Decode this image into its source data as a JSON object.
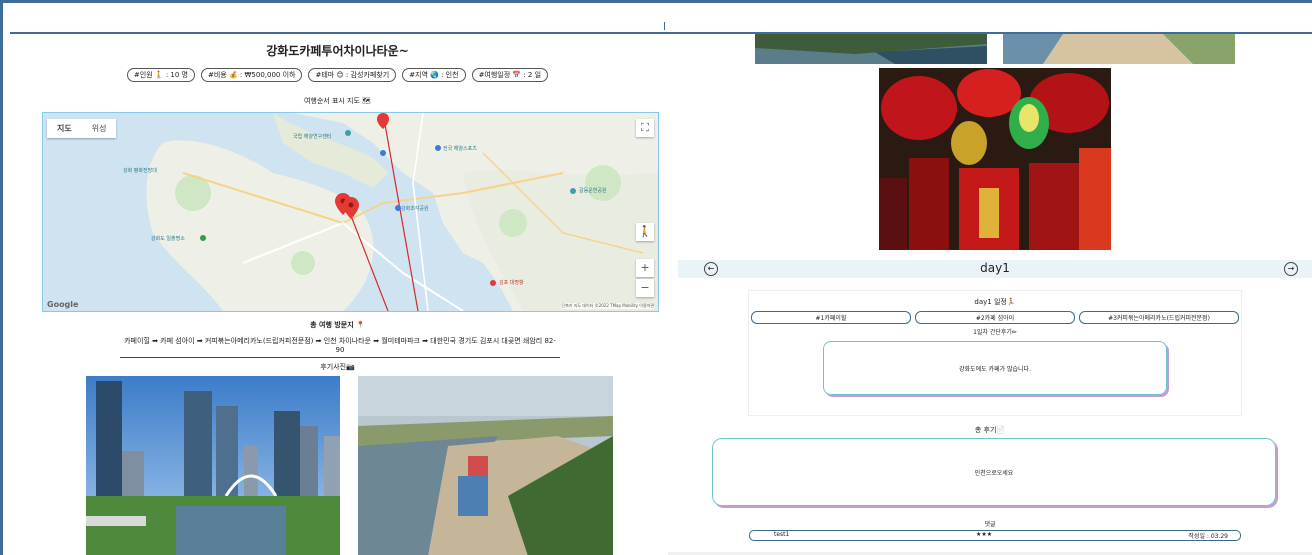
{
  "trip": {
    "title": "강화도카페투어차이나타운~",
    "tags": [
      {
        "label": "#인원 🚶 : 10 명"
      },
      {
        "label": "#비용 💰 : ₩500,000 이하"
      },
      {
        "label": "#테마 😊 : 감성카페찾기"
      },
      {
        "label": "#지역 🌏 : 인천"
      },
      {
        "label": "#여행일정 📅 : 2 일"
      }
    ]
  },
  "map": {
    "caption": "여행순서 표시 지도 🗺",
    "type_tabs": [
      "지도",
      "위성"
    ],
    "google": "Google",
    "footer": "단축키  지도 데이터 ©2022 TMap Mobility  이용약관",
    "labels": [
      {
        "text": "국립 해양연구센터"
      },
      {
        "text": "강화 평화전망대"
      },
      {
        "text": "강화도 일출명소"
      },
      {
        "text": "강화조각공원"
      },
      {
        "text": "갈등운연공원"
      },
      {
        "text": "전국 해양스포츠"
      },
      {
        "text": "김포 대명항"
      }
    ]
  },
  "visits": {
    "caption": "총 여행 방문지 📍",
    "route": "카페이힐 ➡ 카페 섬아이 ➡ 커피볶는아메리카노(드립커피전문점) ➡ 인천 차이나타운 ➡ 월미테마파크 ➡ 대한민국 경기도 김포시 대곶면 쇄암리 82-90"
  },
  "photos": {
    "caption": "후기사진📷"
  },
  "day": {
    "title": "day1",
    "prev_icon": "←",
    "next_icon": "→",
    "schedule_title": "day1 일정🏃",
    "places": [
      "#1카페이힐",
      "#2카페 섬아이",
      "#3커피볶는아메리카노(드립커피전문점)"
    ],
    "memo_title": "1일차 간단후기✏",
    "memo": "강화도에도 카페가 많습니다."
  },
  "review": {
    "title": "총 후기📄",
    "text": "인천으로오세요"
  },
  "comments": {
    "title": "댓글",
    "items": [
      {
        "author": "test1",
        "rating": "★★★",
        "date": "작성일 : 03.29"
      }
    ]
  },
  "colors": {
    "frame": "#3f6d9a",
    "accent_border": "#6fc5cf",
    "accent_shadow": "#c59bd3",
    "route_line": "#d12b2b",
    "pin": "#e53935"
  }
}
